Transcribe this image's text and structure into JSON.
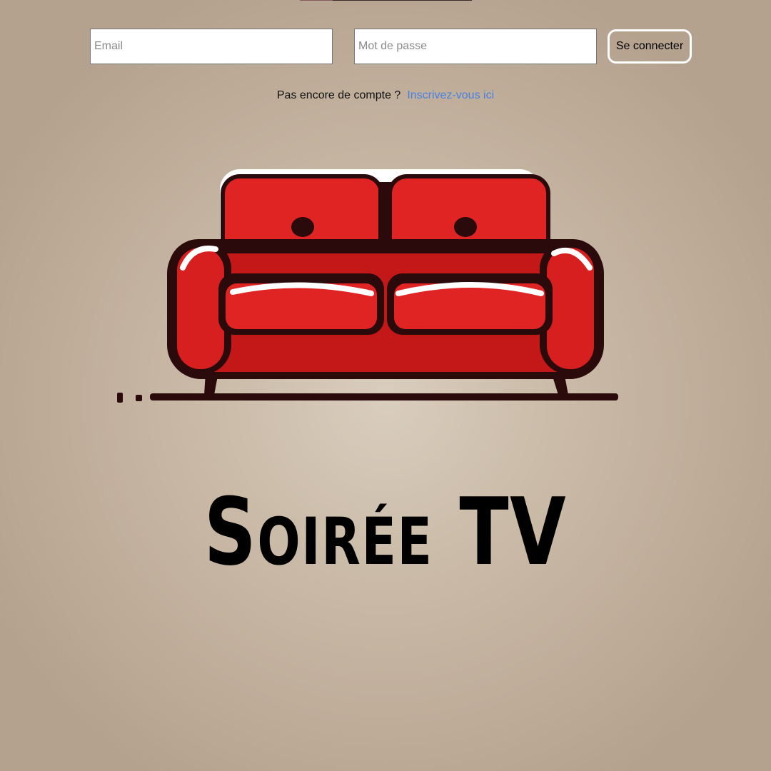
{
  "login": {
    "email_placeholder": "Email",
    "password_placeholder": "Mot de passe",
    "submit_label": "Se connecter"
  },
  "signup": {
    "prompt": "Pas encore de compte ?",
    "link_label": "Inscrivez-vous ici"
  },
  "brand": {
    "title": "Soirée TV",
    "logo_icon": "red-sofa-icon"
  },
  "colors": {
    "link": "#4a80e0",
    "sofa": "#d81f1f",
    "outline": "#2a0a0a"
  }
}
